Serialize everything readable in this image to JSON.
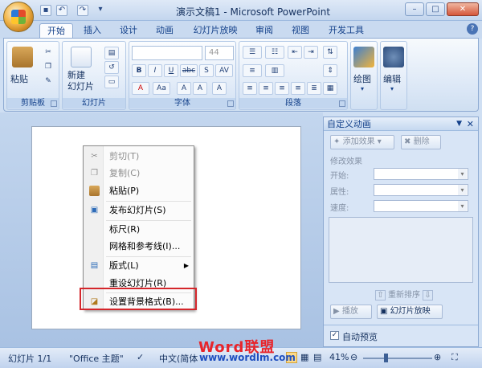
{
  "window": {
    "title": "演示文稿1 - Microsoft PowerPoint",
    "qat": [
      "save-icon",
      "undo-icon",
      "redo-icon"
    ]
  },
  "tabs": [
    "开始",
    "插入",
    "设计",
    "动画",
    "幻灯片放映",
    "审阅",
    "视图",
    "开发工具"
  ],
  "ribbon": {
    "clipboard": {
      "label": "剪贴板",
      "paste": "粘贴"
    },
    "slides": {
      "label": "幻灯片",
      "new_slide": "新建\n幻灯片"
    },
    "font": {
      "label": "字体",
      "size": "44",
      "tools": [
        "B",
        "I",
        "U",
        "abc",
        "S",
        "AV",
        "A",
        "Aa",
        "A",
        "A",
        "A"
      ]
    },
    "paragraph": {
      "label": "段落"
    },
    "drawing": "绘图",
    "editing": "编辑"
  },
  "context_menu": {
    "items": [
      {
        "label": "剪切(T)",
        "icon": "cut-icon",
        "disabled": true
      },
      {
        "label": "复制(C)",
        "icon": "copy-icon",
        "disabled": true
      },
      {
        "label": "粘贴(P)",
        "icon": "paste-icon",
        "disabled": false
      },
      {
        "label": "发布幻灯片(S)",
        "icon": "publish-icon",
        "disabled": false
      },
      {
        "label": "标尺(R)",
        "icon": "",
        "disabled": false
      },
      {
        "label": "网格和参考线(I)...",
        "icon": "",
        "disabled": false
      },
      {
        "label": "版式(L)",
        "icon": "layout-icon",
        "disabled": false,
        "submenu": true
      },
      {
        "label": "重设幻灯片(R)",
        "icon": "",
        "disabled": false
      },
      {
        "label": "设置背景格式(B)...",
        "icon": "background-format-icon",
        "disabled": false,
        "highlighted": true
      }
    ]
  },
  "pane": {
    "title": "自定义动画",
    "add_effect": "添加效果",
    "remove": "删除",
    "modify": "修改效果",
    "start": "开始:",
    "property": "属性:",
    "speed": "速度:",
    "reorder": "重新排序",
    "play": "播放",
    "slideshow": "幻灯片放映",
    "autopreview": "自动预览",
    "autopreview_checked": true
  },
  "status": {
    "slide": "幻灯片 1/1",
    "theme": "\"Office 主题\"",
    "lang": "中文(简体",
    "zoom": "41%"
  },
  "watermark": {
    "brand": "Word联盟",
    "url": "www.wordlm.com"
  }
}
